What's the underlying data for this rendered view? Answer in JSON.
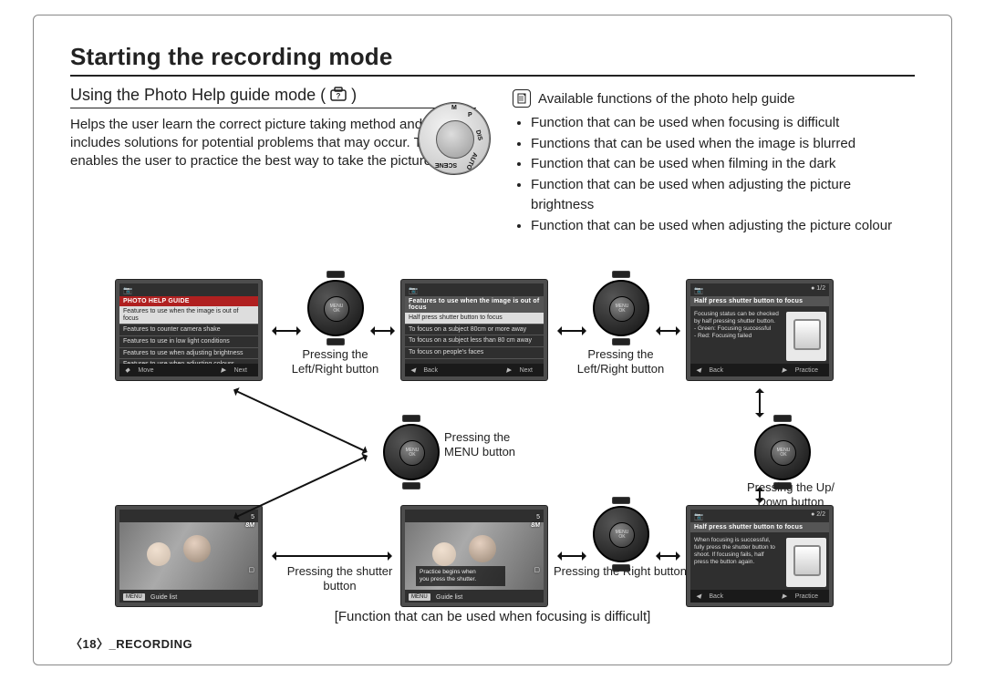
{
  "title": "Starting the recording mode",
  "subtitle_prefix": "Using the Photo Help guide mode ( ",
  "subtitle_suffix": " )",
  "intro": "Helps the user learn the correct picture taking method and includes solutions for potential problems that may occur. This also enables the user to practice the best way to take the pictures.",
  "functions_title": "Available functions of the photo help guide",
  "functions": [
    "Function that can be used when focusing is difficult",
    "Functions that can be used when the image is blurred",
    "Function that can be used when filming in the dark",
    "Function that can be used when adjusting the picture brightness",
    "Function that can be used when adjusting the picture colour"
  ],
  "footer_note": "[Function that can be used when focusing is difficult]",
  "page_footer": "〈18〉_RECORDING",
  "labels": {
    "lr1": "Pressing the\nLeft/Right  button",
    "lr2": "Pressing the\nLeft/Right  button",
    "menu": "Pressing the\nMENU button",
    "updown": "Pressing the Up/\nDown  button",
    "shutter": "Pressing the shutter button",
    "right": "Pressing the Right button"
  },
  "pad_center": "MENU\nOK",
  "mode_dial": {
    "labels": [
      "M",
      "P",
      "DIS",
      "AUTO",
      "SCENE"
    ]
  },
  "screens": {
    "s1": {
      "header": "PHOTO HELP GUIDE",
      "rows": [
        {
          "text": "Features to use when the image is out of focus",
          "hl": true
        },
        {
          "text": "Features to counter camera shake",
          "hl": false
        },
        {
          "text": "Features to use in low light conditions",
          "hl": false
        },
        {
          "text": "Features to use when adjusting brightness",
          "hl": false
        },
        {
          "text": "Features to use when adjusting colours",
          "hl": false
        }
      ],
      "bottom_left_icon": "ud",
      "bottom_left": "Move",
      "bottom_right_icon": "r",
      "bottom_right": "Next"
    },
    "s2": {
      "header": "Features to use when the image is out of focus",
      "rows": [
        {
          "text": "Half press shutter button to focus",
          "hl": true
        },
        {
          "text": "To focus on a subject 80cm or more away",
          "hl": false
        },
        {
          "text": "To focus on a subject less than 80 cm away",
          "hl": false
        },
        {
          "text": "To focus on people's faces",
          "hl": false
        }
      ],
      "bottom_left_icon": "l",
      "bottom_left": "Back",
      "bottom_right_icon": "r",
      "bottom_right": "Next"
    },
    "s3": {
      "page": "● 1/2",
      "header": "Half press shutter button to focus",
      "body": "Focusing status can be checked by half pressing shutter button.\n- Green: Focusing successful\n- Red: Focusing failed",
      "bottom_left_icon": "l",
      "bottom_left": "Back",
      "bottom_right_icon": "r",
      "bottom_right": "Practice"
    },
    "s4": {
      "page": "● 2/2",
      "header": "Half press shutter button to focus",
      "body": "When focusing is successful, fully press the shutter button to shoot. If focusing fails, half press the button again.",
      "bottom_left_icon": "l",
      "bottom_left": "Back",
      "bottom_right_icon": "r",
      "bottom_right": "Practice"
    },
    "photo": {
      "osd_top": "5",
      "osd_mp": "8M",
      "menu_label": "MENU",
      "guide_label": "Guide list"
    },
    "overlay": {
      "line1": "Practice begins when",
      "line2": "you press the shutter."
    }
  }
}
